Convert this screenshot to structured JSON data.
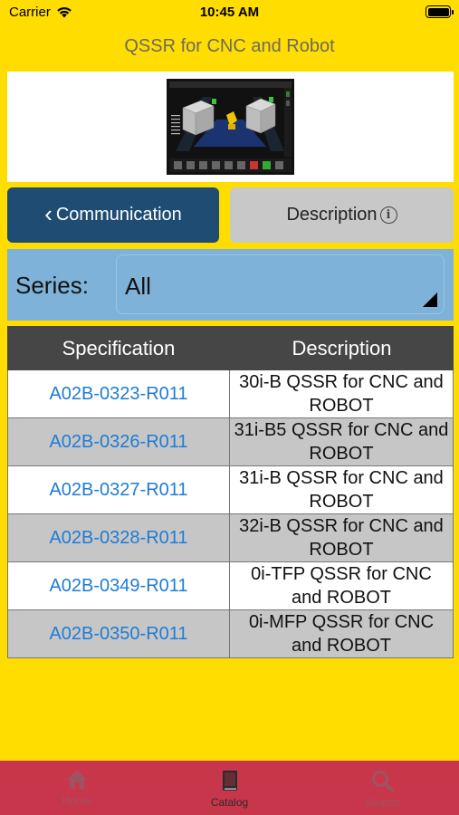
{
  "status_bar": {
    "carrier": "Carrier",
    "time": "10:45 AM"
  },
  "nav": {
    "title": "QSSR for CNC and Robot"
  },
  "tabs": {
    "communication": {
      "label": "Communication",
      "icon": "chevron-left-icon"
    },
    "description": {
      "label": "Description",
      "icon": "info-icon"
    }
  },
  "filter": {
    "label": "Series:",
    "selected": "All"
  },
  "table": {
    "headers": [
      "Specification",
      "Description"
    ],
    "rows": [
      {
        "spec": "A02B-0323-R011",
        "desc": "30i-B QSSR for CNC and ROBOT"
      },
      {
        "spec": "A02B-0326-R011",
        "desc": "31i-B5 QSSR for CNC and ROBOT"
      },
      {
        "spec": "A02B-0327-R011",
        "desc": "31i-B QSSR for CNC and ROBOT"
      },
      {
        "spec": "A02B-0328-R011",
        "desc": "32i-B QSSR for CNC and ROBOT"
      },
      {
        "spec": "A02B-0349-R011",
        "desc": "0i-TFP QSSR for CNC and ROBOT"
      },
      {
        "spec": "A02B-0350-R011",
        "desc": "0i-MFP QSSR for CNC and ROBOT"
      }
    ]
  },
  "tabbar": {
    "items": [
      {
        "label": "Home",
        "icon": "home-icon",
        "active": false
      },
      {
        "label": "Catalog",
        "icon": "book-icon",
        "active": true
      },
      {
        "label": "Search",
        "icon": "search-icon",
        "active": false
      }
    ]
  },
  "colors": {
    "background": "#FFDD00",
    "tab_active": "#1F4C72",
    "tab_inactive": "#C8C8C8",
    "filter_bg": "#7FB2D8",
    "table_header": "#464646",
    "link": "#1E7BD6",
    "tabbar_bg": "#C8364C"
  }
}
